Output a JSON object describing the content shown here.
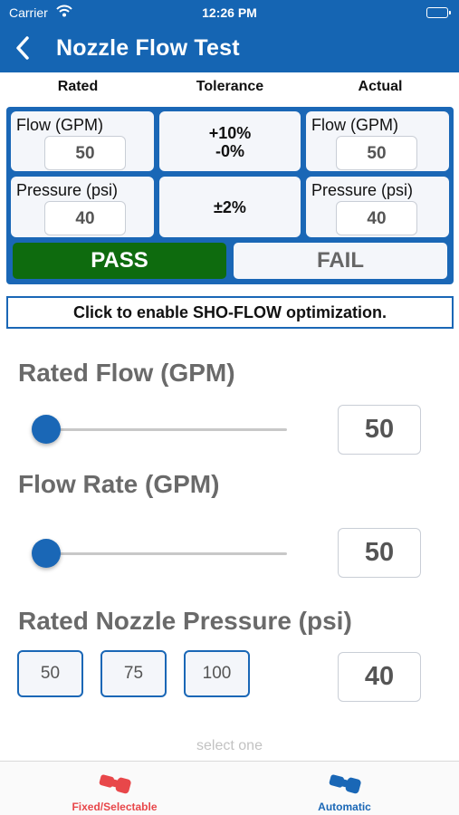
{
  "status_bar": {
    "carrier": "Carrier",
    "time": "12:26 PM"
  },
  "nav": {
    "title": "Nozzle Flow Test",
    "back_icon": "chevron-left-icon"
  },
  "columns": {
    "rated": "Rated",
    "tolerance": "Tolerance",
    "actual": "Actual"
  },
  "rated": {
    "flow_label": "Flow (GPM)",
    "flow_value": "50",
    "pressure_label": "Pressure (psi)",
    "pressure_value": "40"
  },
  "tolerance": {
    "flow_line1": "+10%",
    "flow_line2": "-0%",
    "pressure": "±2%"
  },
  "actual": {
    "flow_label": "Flow (GPM)",
    "flow_value": "50",
    "pressure_label": "Pressure (psi)",
    "pressure_value": "40"
  },
  "result": {
    "pass_label": "PASS",
    "fail_label": "FAIL",
    "selected": "PASS"
  },
  "sho_flow_button": "Click to enable SHO-FLOW optimization.",
  "rated_flow": {
    "title": "Rated Flow (GPM)",
    "value": "50",
    "slider_level": 0
  },
  "flow_rate": {
    "title": "Flow Rate (GPM)",
    "value": "50",
    "slider_level": 0
  },
  "rated_pressure": {
    "title": "Rated Nozzle Pressure (psi)",
    "options": [
      "50",
      "75",
      "100"
    ],
    "value": "40"
  },
  "hint": "select one",
  "tabs": [
    {
      "label": "Fixed/Selectable",
      "icon": "nozzle-icon",
      "color": "#e8474a"
    },
    {
      "label": "Automatic",
      "icon": "nozzle-icon",
      "color": "#1a67b6",
      "selected": true
    }
  ],
  "colors": {
    "brand_blue": "#1565b3",
    "pass_green": "#0e6b0e",
    "fixed_red": "#e8474a"
  }
}
